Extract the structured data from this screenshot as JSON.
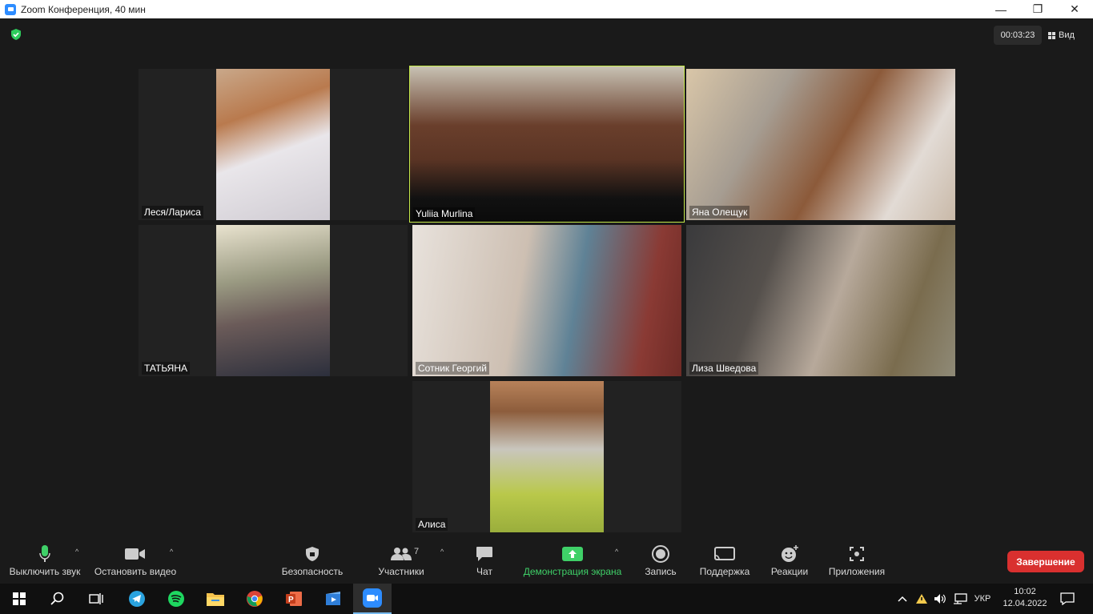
{
  "window": {
    "title": "Zoom Конференция, 40 мин",
    "minimize": "—",
    "restore": "❐",
    "close": "✕"
  },
  "meeting": {
    "timer": "00:03:23",
    "view_label": "Вид",
    "participants": [
      {
        "name": "Леся/Лариса",
        "active": false
      },
      {
        "name": "Yuliia Murlina",
        "active": true
      },
      {
        "name": "Яна Олещук",
        "active": false
      },
      {
        "name": "ТАТЬЯНА",
        "active": false
      },
      {
        "name": "Сотник Георгий",
        "active": false
      },
      {
        "name": "Лиза Шведова",
        "active": false
      },
      {
        "name": "Алиса",
        "active": false
      }
    ]
  },
  "toolbar": {
    "mute": "Выключить звук",
    "video": "Остановить видео",
    "security": "Безопасность",
    "participants": "Участники",
    "participants_count": "7",
    "chat": "Чат",
    "share": "Демонстрация экрана",
    "record": "Запись",
    "support": "Поддержка",
    "reactions": "Реакции",
    "apps": "Приложения",
    "end": "Завершение",
    "accent_green": "#3fd068",
    "end_color": "#d9302f"
  },
  "taskbar": {
    "language": "УКР",
    "time": "10:02",
    "date": "12.04.2022",
    "apps": [
      "windows-start-icon",
      "search-icon",
      "task-view-icon",
      "telegram-icon",
      "spotify-icon",
      "file-explorer-icon",
      "chrome-icon",
      "powerpoint-icon",
      "media-player-icon",
      "zoom-icon"
    ]
  }
}
